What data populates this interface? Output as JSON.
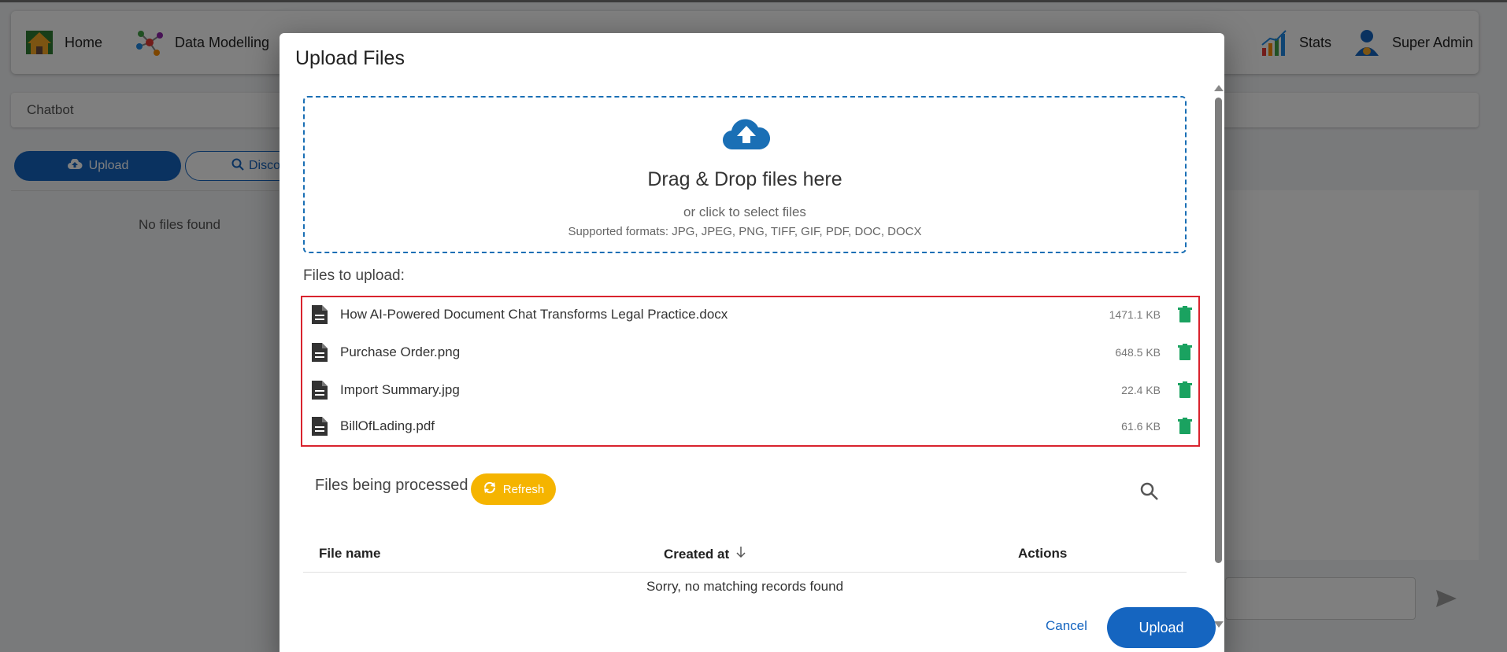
{
  "app": {
    "nav": {
      "home": "Home",
      "data_modelling": "Data Modelling",
      "stats": "Stats",
      "user": "Super Admin"
    },
    "breadcrumb": "Chatbot",
    "upload_button": "Upload",
    "discover_button": "Disco",
    "no_files": "No files found"
  },
  "modal": {
    "title": "Upload Files",
    "dropzone": {
      "title": "Drag & Drop files here",
      "subtitle": "or click to select files",
      "formats": "Supported formats: JPG, JPEG, PNG, TIFF, GIF, PDF, DOC, DOCX"
    },
    "files_label": "Files to upload:",
    "files": [
      {
        "name": "How AI-Powered Document Chat Transforms Legal Practice.docx",
        "size": "1471.1 KB"
      },
      {
        "name": "Purchase Order.png",
        "size": "648.5 KB"
      },
      {
        "name": "Import Summary.jpg",
        "size": "22.4 KB"
      },
      {
        "name": "BillOfLading.pdf",
        "size": "61.6 KB"
      }
    ],
    "processing": {
      "label": "Files being processed",
      "refresh": "Refresh"
    },
    "table": {
      "columns": {
        "file_name": "File name",
        "created_at": "Created at",
        "actions": "Actions"
      },
      "empty": "Sorry, no matching records found"
    },
    "cancel": "Cancel",
    "upload": "Upload"
  },
  "colors": {
    "primary": "#1565c0",
    "refresh": "#f5b400",
    "trash": "#1aa260",
    "highlight": "#d9232e"
  }
}
